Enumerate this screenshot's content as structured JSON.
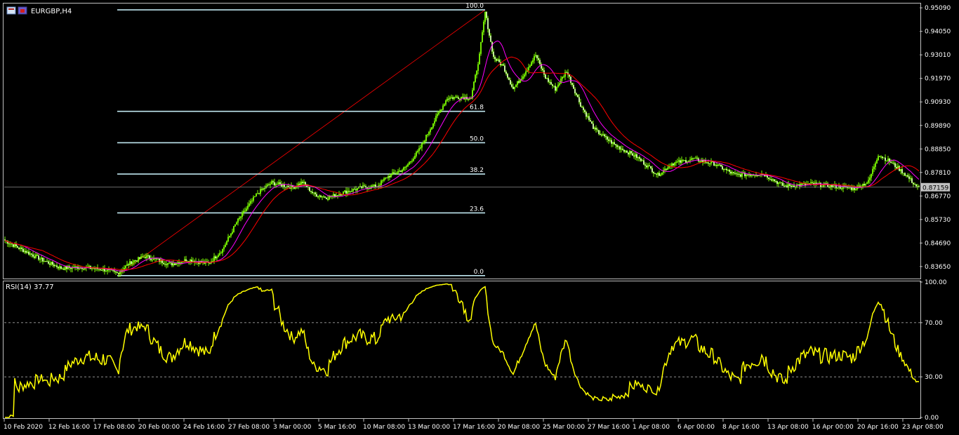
{
  "window": {
    "symbol_label": "EURGBP,H4",
    "icon": "chart-window-icon"
  },
  "colors": {
    "background": "#000000",
    "frame": "#c0c0c0",
    "bull_candle": "#7cfc00",
    "bear_candle": "#ffffff",
    "ma_fast": "#ff00ff",
    "ma_slow": "#ff0000",
    "fib_level": "#bfe6ef",
    "fib_trend": "#ff0000",
    "rsi": "#ffff00",
    "current_price_bg": "#c0c0c0"
  },
  "chart_data": [
    {
      "type": "candlestick",
      "title": "EURGBP,H4",
      "ylim": [
        0.8315,
        0.9525
      ],
      "y_ticks": [
        "0.95090",
        "0.94050",
        "0.93010",
        "0.91970",
        "0.90930",
        "0.89890",
        "0.88850",
        "0.87810",
        "0.86770",
        "0.85730",
        "0.84690",
        "0.83650"
      ],
      "x_ticks": [
        "10 Feb 2020",
        "12 Feb 16:00",
        "17 Feb 08:00",
        "20 Feb 00:00",
        "24 Feb 16:00",
        "27 Feb 08:00",
        "3 Mar 00:00",
        "5 Mar 16:00",
        "10 Mar 08:00",
        "13 Mar 00:00",
        "17 Mar 16:00",
        "20 Mar 08:00",
        "25 Mar 00:00",
        "27 Mar 16:00",
        "1 Apr 08:00",
        "6 Apr 00:00",
        "8 Apr 16:00",
        "13 Apr 08:00",
        "16 Apr 00:00",
        "20 Apr 16:00",
        "23 Apr 08:00"
      ],
      "current_price": "0.87159",
      "close_anchors": [
        [
          0,
          0.848
        ],
        [
          12,
          0.844
        ],
        [
          28,
          0.839
        ],
        [
          40,
          0.8358
        ],
        [
          55,
          0.8362
        ],
        [
          70,
          0.8352
        ],
        [
          80,
          0.8335
        ],
        [
          90,
          0.8385
        ],
        [
          100,
          0.841
        ],
        [
          118,
          0.8375
        ],
        [
          130,
          0.8395
        ],
        [
          145,
          0.8378
        ],
        [
          155,
          0.844
        ],
        [
          165,
          0.856
        ],
        [
          180,
          0.869
        ],
        [
          190,
          0.8735
        ],
        [
          205,
          0.8715
        ],
        [
          212,
          0.8738
        ],
        [
          220,
          0.8685
        ],
        [
          230,
          0.867
        ],
        [
          245,
          0.87
        ],
        [
          255,
          0.8715
        ],
        [
          265,
          0.872
        ],
        [
          272,
          0.876
        ],
        [
          285,
          0.88
        ],
        [
          295,
          0.888
        ],
        [
          305,
          0.9
        ],
        [
          315,
          0.911
        ],
        [
          325,
          0.9115
        ],
        [
          332,
          0.911
        ],
        [
          338,
          0.93
        ],
        [
          342,
          0.949
        ],
        [
          348,
          0.929
        ],
        [
          355,
          0.925
        ],
        [
          362,
          0.915
        ],
        [
          370,
          0.922
        ],
        [
          378,
          0.93
        ],
        [
          385,
          0.92
        ],
        [
          392,
          0.915
        ],
        [
          400,
          0.923
        ],
        [
          410,
          0.908
        ],
        [
          420,
          0.897
        ],
        [
          435,
          0.89
        ],
        [
          450,
          0.885
        ],
        [
          465,
          0.877
        ],
        [
          475,
          0.882
        ],
        [
          490,
          0.884
        ],
        [
          505,
          0.882
        ],
        [
          520,
          0.877
        ],
        [
          540,
          0.8775
        ],
        [
          555,
          0.872
        ],
        [
          575,
          0.873
        ],
        [
          590,
          0.872
        ],
        [
          605,
          0.871
        ],
        [
          615,
          0.874
        ],
        [
          622,
          0.886
        ],
        [
          630,
          0.883
        ],
        [
          640,
          0.878
        ],
        [
          650,
          0.8715
        ]
      ],
      "series": [
        {
          "name": "",
          "kind": "moving-average",
          "period": 14,
          "color": "#ff00ff"
        },
        {
          "name": "",
          "kind": "moving-average",
          "period": 28,
          "color": "#ff0000"
        }
      ],
      "fibonacci": {
        "from_index": 80,
        "to_index": 342,
        "end_index": 342,
        "low": 0.8325,
        "high": 0.95,
        "levels": [
          {
            "label": "100.0",
            "ratio": 1.0
          },
          {
            "label": "61.8",
            "ratio": 0.618
          },
          {
            "label": "50.0",
            "ratio": 0.5
          },
          {
            "label": "38.2",
            "ratio": 0.382
          },
          {
            "label": "23.6",
            "ratio": 0.236
          },
          {
            "label": "0.0",
            "ratio": 0.0
          }
        ]
      }
    },
    {
      "type": "line",
      "title": "RSI(14) 37.77",
      "ylim": [
        0,
        100
      ],
      "y_ticks": [
        "100.00",
        "70.00",
        "30.00",
        "0.00"
      ],
      "levels": [
        70,
        30
      ],
      "series": [
        {
          "name": "RSI(14)",
          "kind": "rsi",
          "period": 14,
          "color": "#ffff00"
        }
      ]
    }
  ]
}
